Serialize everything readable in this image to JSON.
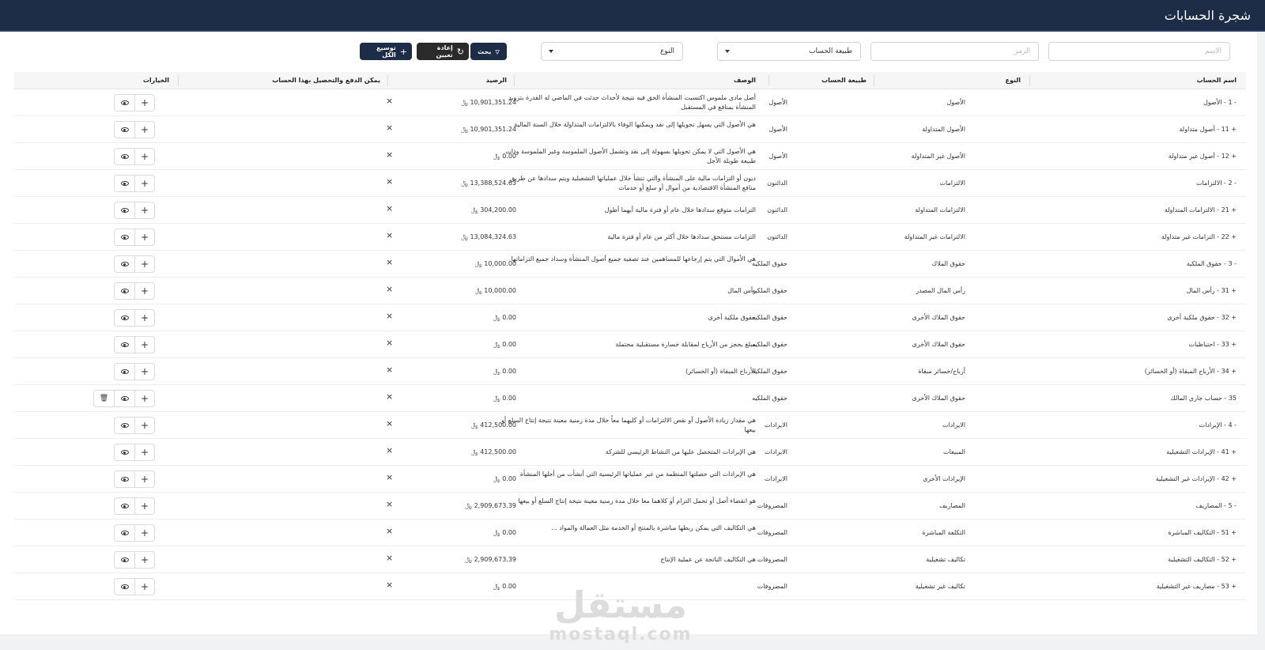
{
  "header": {
    "title": "شجرة الحسابات"
  },
  "filters": {
    "name_placeholder": "الاسم",
    "code_placeholder": "الرمز",
    "nature_select": "طبيعة الحساب",
    "type_select": "النوع",
    "search_label": "بحث",
    "reset_label": "إعادة تعيين",
    "expand_label": "توسيع الكل"
  },
  "table": {
    "headers": {
      "name": "اسم الحساب",
      "type": "النوع",
      "nature": "طبيعة الحساب",
      "description": "الوصف",
      "balance": "الرصيد",
      "payable": "يمكن الدفع والتحصيل بهذا الحساب",
      "options": "الخيارات"
    },
    "rows": [
      {
        "name": "- 1 - الأصول",
        "type": "الأصول",
        "nature": "الأصول",
        "description": "أصل مادي ملموس اكتسبت المنشأة الحق فيه نتيجة لأحداث حدثت في الماضي له القدرة بتزويد المنشأة بمنافع في المستقبل",
        "balance": "10,901,351.24 ﷼",
        "payable": "×"
      },
      {
        "name": "+ 11 - أصول متداولة",
        "type": "الأصول المتداولة",
        "nature": "الأصول",
        "description": "هي الأصول التي يسهل تحويلها إلى نقد ويمكنها الوفاء بالالتزامات المتداولة خلال السنة المالية",
        "balance": "10,901,351.24 ﷼",
        "payable": "×"
      },
      {
        "name": "+ 12 - أصول غير متداولة",
        "type": "الأصول غير المتداولة",
        "nature": "الأصول",
        "description": "هي الأصول التي لا يمكن تحويلها بسهولة إلى نقد وتشمل الأصول الملموسة وغير الملموسة وذات طبيعة طويلة الأجل",
        "balance": "0.00 ﷼",
        "payable": "×"
      },
      {
        "name": "- 2 - الالتزامات",
        "type": "الالتزامات",
        "nature": "الدائنون",
        "description": "ديون أو التزامات مالية على المنشأة والتي تنشأ خلال عملياتها التشغيلية ويتم سدادها عن طريق منافع المنشأة الاقتصادية من أموال أو سلع أو خدمات",
        "balance": "13,388,524.63 ﷼",
        "payable": "×"
      },
      {
        "name": "+ 21 - الالتزامات المتداولة",
        "type": "الالتزامات المتداولة",
        "nature": "الدائنون",
        "description": "التزامات متوقع سدادها خلال عام أو فترة مالية أيهما أطول",
        "balance": "304,200.00 ﷼",
        "payable": "×"
      },
      {
        "name": "+ 22 - التزامات غير متداولة",
        "type": "الالتزامات غير المتداولة",
        "nature": "الدائنون",
        "description": "التزامات مستحق سدادها خلال أكثر من عام أو فترة مالية",
        "balance": "13,084,324.63 ﷼",
        "payable": "×"
      },
      {
        "name": "- 3 - حقوق الملكية",
        "type": "حقوق الملاك",
        "nature": "حقوق الملكيه",
        "description": "هي الأموال التي يتم إرجاعها للمساهمين عند تصفية جميع أصول المنشأة وسداد جميع التزاماتها",
        "balance": "10,000.00 ﷼",
        "payable": "×"
      },
      {
        "name": "+ 31 - رأس المال",
        "type": "رأس المال المصدر",
        "nature": "حقوق الملكيه",
        "description": "رأس المال",
        "balance": "10,000.00 ﷼",
        "payable": "×"
      },
      {
        "name": "+ 32 - حقوق ملكية أخرى",
        "type": "حقوق الملاك الأخرى",
        "nature": "حقوق الملكيه",
        "description": "حقوق ملكية أخرى",
        "balance": "0.00 ﷼",
        "payable": "×"
      },
      {
        "name": "+ 33 - احتياطيات",
        "type": "حقوق الملاك الأخرى",
        "nature": "حقوق الملكيه",
        "description": "مبلغ يحجز من الأرباح لمقابلة خسارة مستقبلية محتملة",
        "balance": "0.00 ﷼",
        "payable": "×"
      },
      {
        "name": "+ 34 - الأرباح المبقاة (أو الخسائر)",
        "type": "أرباح/خسائر مبقاة",
        "nature": "حقوق الملكيه",
        "description": "الأرباح المبقاة (أو الخسائر)",
        "balance": "0.00 ﷼",
        "payable": "×"
      },
      {
        "name": "35 - حساب جاري المالك",
        "type": "حقوق الملاك الأخرى",
        "nature": "حقوق الملكيه",
        "description": "",
        "balance": "0.00 ﷼",
        "payable": "×"
      },
      {
        "name": "- 4 - الإيرادات",
        "type": "الايرادات",
        "nature": "الايرادات",
        "description": "هي مقدار زيادة الأصول أو نقص الالتزامات أو كليهما معاً خلال مدة زمنية معينة نتيجة إنتاج السلع أو بيعها",
        "balance": "412,500.00 ﷼",
        "payable": "×"
      },
      {
        "name": "+ 41 - الإيرادات التشغيلية",
        "type": "المبيعات",
        "nature": "الايرادات",
        "description": "هي الإيرادات المتحصل عليها من النشاط الرئيسي للشركة",
        "balance": "412,500.00 ﷼",
        "payable": "×"
      },
      {
        "name": "+ 42 - الإيرادات غير التشغيلية",
        "type": "الإيرادات الأخرى",
        "nature": "الايرادات",
        "description": "هي الإيرادات التي حصلتها المنظمة من غير عملياتها الرئيسية التي أنشأت من أجلها المنشأة",
        "balance": "0.00 ﷼",
        "payable": "×"
      },
      {
        "name": "- 5 - المصاريف",
        "type": "المصاريف",
        "nature": "المصروفات",
        "description": "هو انقضاء أصل أو تحمل التزام أو كلاهما معا خلال مدة زمنية معينة نتيجة إنتاج السلع أو بيعها",
        "balance": "2,909,673.39 ﷼",
        "payable": "×"
      },
      {
        "name": "+ 51 - التكاليف المباشرة",
        "type": "التكلفة المباشرة",
        "nature": "المصروفات",
        "description": "هي التكاليف التي يمكن ربطها مباشرة بالمنتج أو الخدمة مثل العمالة والمواد ...",
        "balance": "0.00 ﷼",
        "payable": "×"
      },
      {
        "name": "+ 52 - التكاليف التشغيلية",
        "type": "تكاليف تشغيلية",
        "nature": "المصروفات",
        "description": "هي التكاليف الناتجة عن عملية الإنتاج",
        "balance": "2,909,673.39 ﷼",
        "payable": "×"
      },
      {
        "name": "+ 53 - مصاريف غير التشغيلية",
        "type": "تكاليف غير تشغيلية",
        "nature": "المصروفات",
        "description": "",
        "balance": "0.00 ﷼",
        "payable": "×"
      }
    ]
  },
  "icons": {
    "add": "plus-icon",
    "view": "eye-icon",
    "delete": "trash-icon",
    "filter": "filter-icon",
    "refresh": "refresh-icon"
  },
  "watermark": {
    "arabic": "مستقل",
    "latin": "mostaql.com"
  },
  "colors": {
    "header_bg": "#1d2d47",
    "primary_button": "#1d2d47",
    "reset_button": "#2a2a2a"
  }
}
